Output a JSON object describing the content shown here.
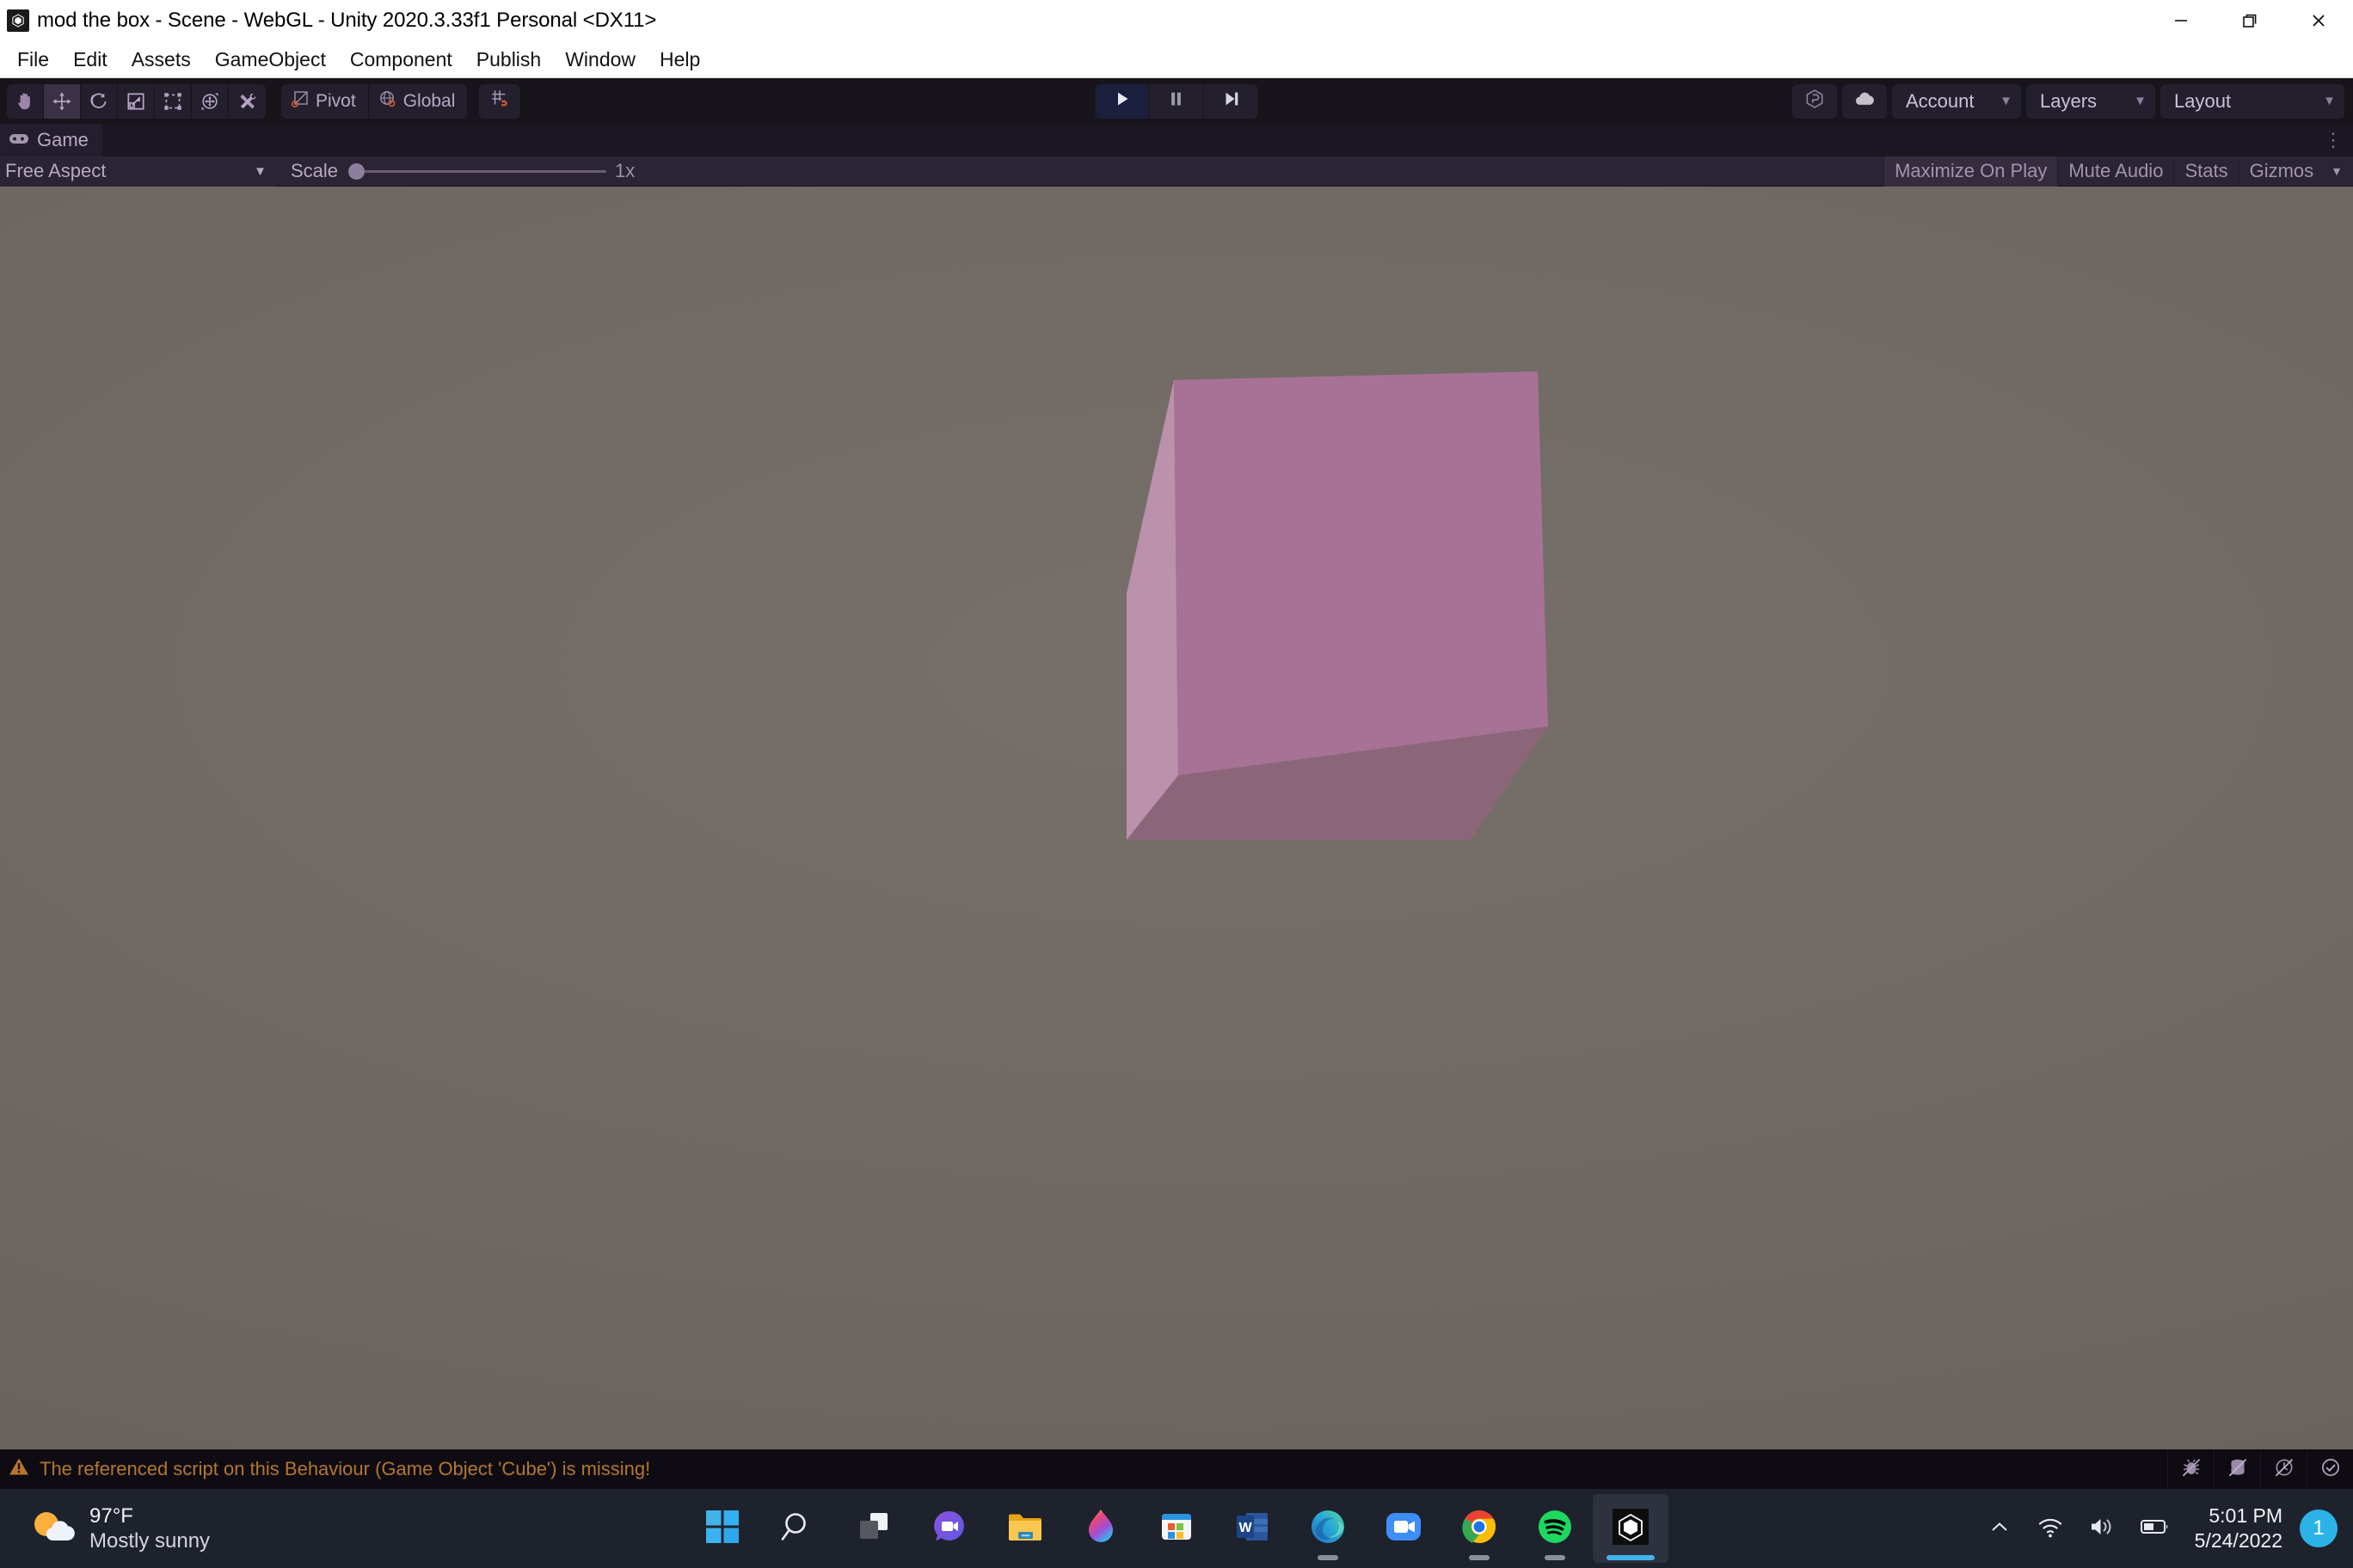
{
  "window": {
    "title": "mod the box - Scene - WebGL - Unity 2020.3.33f1 Personal <DX11>",
    "app_icon": "unity-icon",
    "controls": {
      "minimize": "minimize-icon",
      "maximize": "restore-icon",
      "close": "close-icon"
    }
  },
  "menubar": {
    "items": [
      {
        "label": "File"
      },
      {
        "label": "Edit"
      },
      {
        "label": "Assets"
      },
      {
        "label": "GameObject"
      },
      {
        "label": "Component"
      },
      {
        "label": "Publish"
      },
      {
        "label": "Window"
      },
      {
        "label": "Help"
      }
    ]
  },
  "toolbar": {
    "transform_tools": [
      {
        "name": "hand-tool",
        "icon": "hand-icon",
        "active": false
      },
      {
        "name": "move-tool",
        "icon": "move-icon",
        "active": true
      },
      {
        "name": "rotate-tool",
        "icon": "rotate-icon",
        "active": false
      },
      {
        "name": "scale-tool",
        "icon": "scale-icon",
        "active": false
      },
      {
        "name": "rect-tool",
        "icon": "rect-transform-icon",
        "active": false
      },
      {
        "name": "transform-tool",
        "icon": "transform-icon",
        "active": false
      },
      {
        "name": "custom-editor-tool",
        "icon": "wrench-pencil-icon",
        "active": false
      }
    ],
    "pivot_mode": "Pivot",
    "pivot_rotation": "Global",
    "snap_tool": "grid-snap-icon",
    "playback": {
      "play": "play-icon",
      "pause": "pause-icon",
      "step": "step-icon",
      "play_engaged": true
    },
    "collab_icon": "collab-icon",
    "cloud_icon": "cloud-icon",
    "account_label": "Account",
    "layers_label": "Layers",
    "layout_label": "Layout"
  },
  "panel": {
    "tab_label": "Game",
    "tab_icon": "gamepad-icon",
    "overflow_menu": "panel-menu-icon"
  },
  "gameview": {
    "aspect_label": "Free Aspect",
    "scale_label": "Scale",
    "scale_value": "1x",
    "scale_position_pct": 0,
    "maximize_on_play": "Maximize On Play",
    "mute_audio": "Mute Audio",
    "stats": "Stats",
    "gizmos": "Gizmos",
    "scene": {
      "background_color": "#6e6762",
      "object_name": "Cube",
      "cube_top_color": "#c498b4",
      "cube_front_color": "#9c6d8c",
      "cube_side_color": "#c096ae",
      "cube_bottom_color": "#7e5e70"
    }
  },
  "statusbar": {
    "warning_icon": "warning-triangle-icon",
    "message": "The referenced script on this Behaviour (Game Object 'Cube') is missing!",
    "icons": [
      {
        "name": "debug-bug-off-icon"
      },
      {
        "name": "code-optimization-icon"
      },
      {
        "name": "auto-refresh-off-icon"
      },
      {
        "name": "status-ok-icon"
      }
    ]
  },
  "taskbar": {
    "weather": {
      "icon": "sun-cloud-icon",
      "temperature": "97°F",
      "description": "Mostly sunny"
    },
    "apps": [
      {
        "name": "start-button",
        "icon": "windows-logo-icon",
        "running": false,
        "active": false
      },
      {
        "name": "search-button",
        "icon": "search-icon",
        "running": false,
        "active": false
      },
      {
        "name": "task-view-button",
        "icon": "task-view-icon",
        "running": false,
        "active": false
      },
      {
        "name": "chat-button",
        "icon": "chat-teams-icon",
        "running": false,
        "active": false
      },
      {
        "name": "file-explorer-button",
        "icon": "folder-icon",
        "running": false,
        "active": false
      },
      {
        "name": "paint-button",
        "icon": "paint-icon",
        "running": false,
        "active": false
      },
      {
        "name": "microsoft-store-button",
        "icon": "store-icon",
        "running": false,
        "active": false
      },
      {
        "name": "word-button",
        "icon": "word-icon",
        "running": false,
        "active": false
      },
      {
        "name": "edge-button",
        "icon": "edge-icon",
        "running": true,
        "active": false
      },
      {
        "name": "zoom-button",
        "icon": "zoom-icon",
        "running": false,
        "active": false
      },
      {
        "name": "chrome-button",
        "icon": "chrome-icon",
        "running": true,
        "active": false
      },
      {
        "name": "spotify-button",
        "icon": "spotify-icon",
        "running": true,
        "active": false
      },
      {
        "name": "unity-button",
        "icon": "unity-icon",
        "running": true,
        "active": true
      }
    ],
    "tray": {
      "overflow_icon": "chevron-up-icon",
      "wifi_icon": "wifi-icon",
      "volume_icon": "speaker-icon",
      "battery_icon": "battery-icon",
      "time": "5:01 PM",
      "date": "5/24/2022",
      "notification_count": "1"
    }
  }
}
